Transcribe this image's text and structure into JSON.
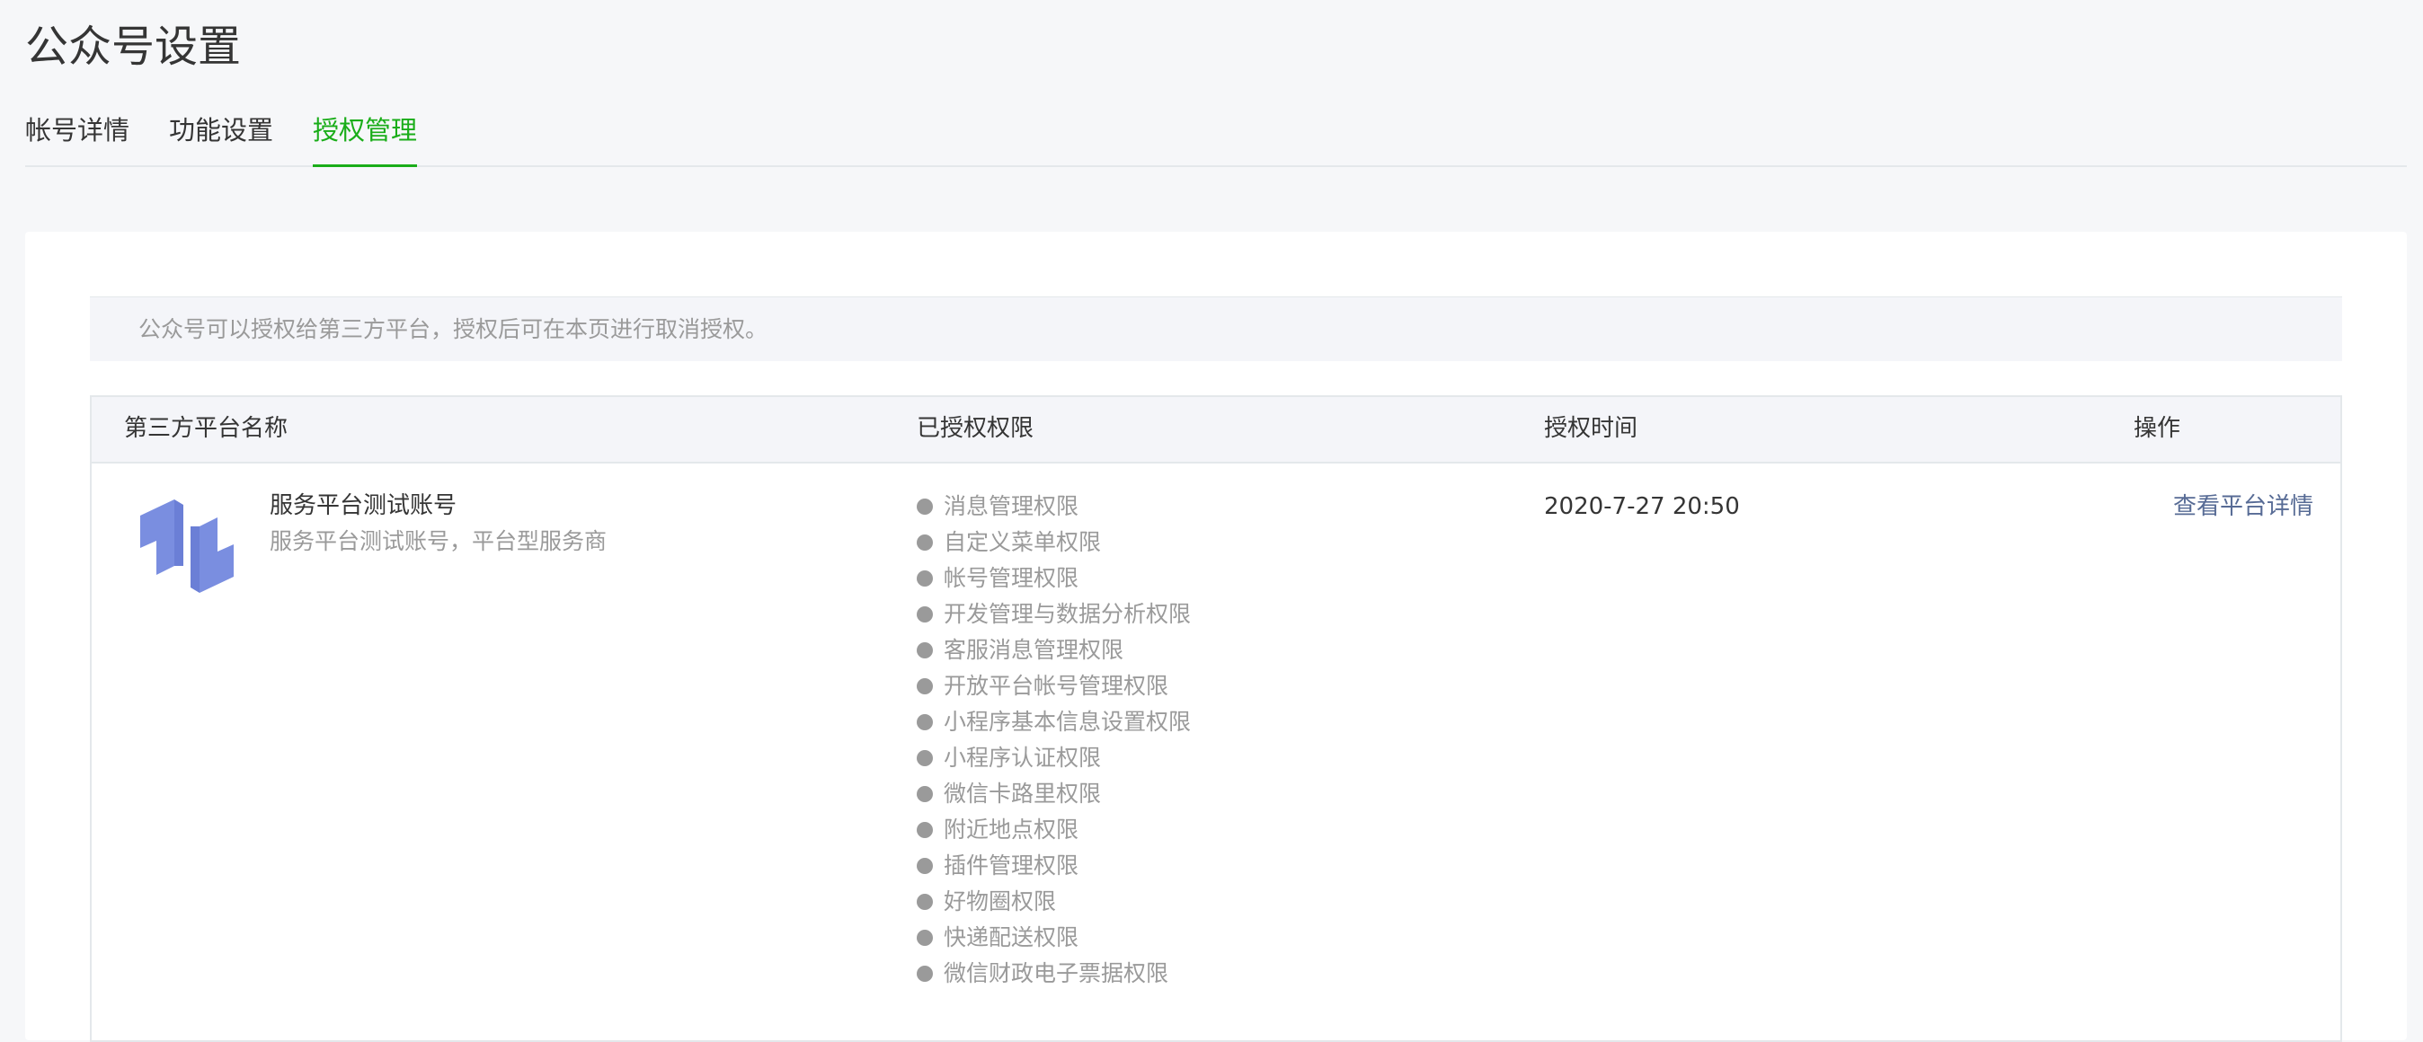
{
  "page": {
    "title": "公众号设置"
  },
  "tabs": [
    {
      "label": "帐号详情",
      "active": false
    },
    {
      "label": "功能设置",
      "active": false
    },
    {
      "label": "授权管理",
      "active": true
    }
  ],
  "colors": {
    "accent": "#1aad19",
    "link": "#576b95",
    "logo": "#7a8ee0"
  },
  "notice": "公众号可以授权给第三方平台，授权后可在本页进行取消授权。",
  "table": {
    "headers": {
      "name": "第三方平台名称",
      "permissions": "已授权权限",
      "time": "授权时间",
      "action": "操作"
    },
    "rows": [
      {
        "logo_icon": "platform-logo-icon",
        "name": "服务平台测试账号",
        "description": "服务平台测试账号，平台型服务商",
        "permissions": [
          "消息管理权限",
          "自定义菜单权限",
          "帐号管理权限",
          "开发管理与数据分析权限",
          "客服消息管理权限",
          "开放平台帐号管理权限",
          "小程序基本信息设置权限",
          "小程序认证权限",
          "微信卡路里权限",
          "附近地点权限",
          "插件管理权限",
          "好物圈权限",
          "快递配送权限",
          "微信财政电子票据权限"
        ],
        "time": "2020-7-27 20:50",
        "action": "查看平台详情"
      }
    ]
  }
}
